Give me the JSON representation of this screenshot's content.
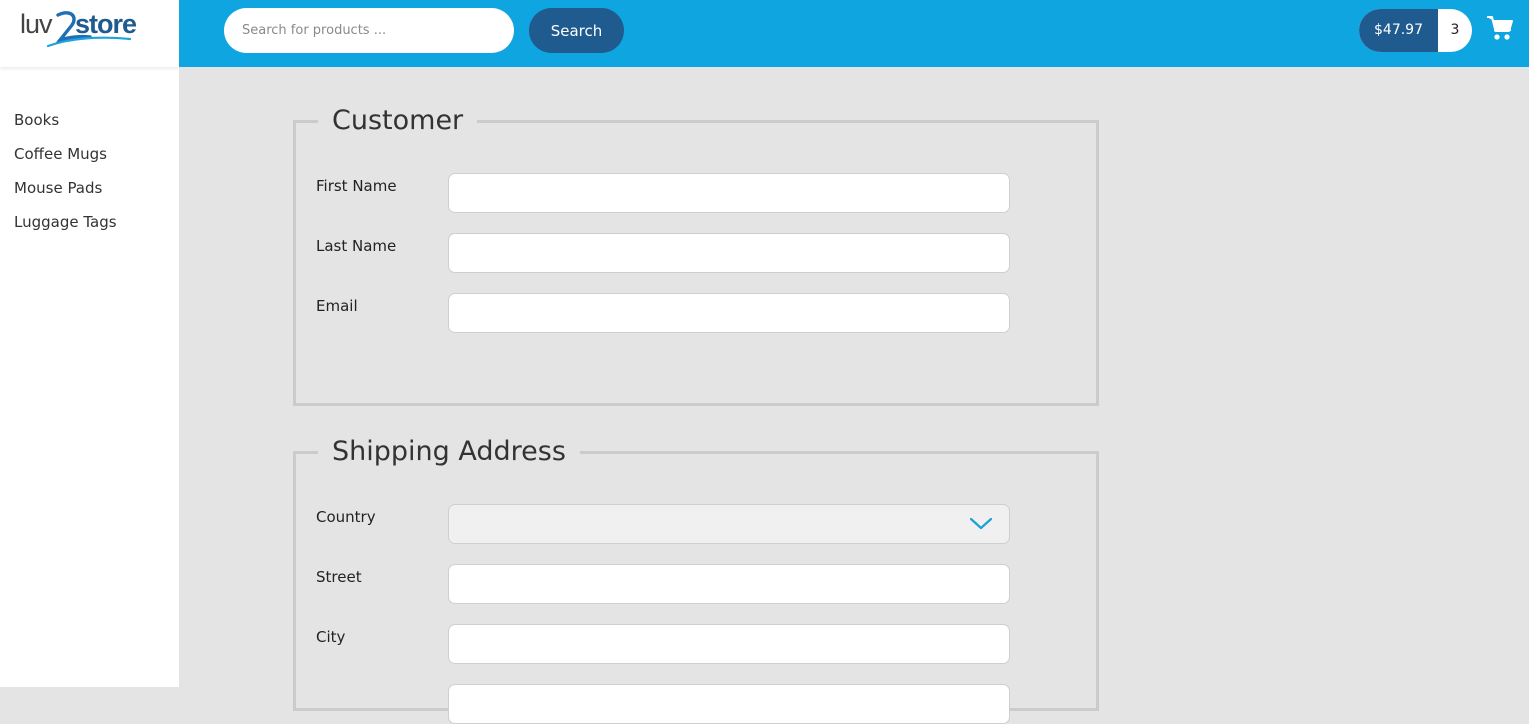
{
  "brand": {
    "logo_text": "luv2store",
    "accent": "#0ea5e0",
    "dark_blue": "#1f5b8e"
  },
  "sidebar": {
    "items": [
      {
        "label": "Books"
      },
      {
        "label": "Coffee Mugs"
      },
      {
        "label": "Mouse Pads"
      },
      {
        "label": "Luggage Tags"
      }
    ]
  },
  "header": {
    "search_placeholder": "Search for products ...",
    "search_value": "",
    "search_button": "Search",
    "cart_total": "$47.97",
    "cart_count": "3",
    "cart_icon": "shopping-cart-icon"
  },
  "customer": {
    "legend": "Customer",
    "fields": [
      {
        "label": "First Name",
        "value": ""
      },
      {
        "label": "Last Name",
        "value": ""
      },
      {
        "label": "Email",
        "value": ""
      }
    ]
  },
  "shipping": {
    "legend": "Shipping Address",
    "country_label": "Country",
    "country_value": "",
    "country_icon": "chevron-down-icon",
    "fields": [
      {
        "label": "Street",
        "value": ""
      },
      {
        "label": "City",
        "value": ""
      }
    ]
  }
}
